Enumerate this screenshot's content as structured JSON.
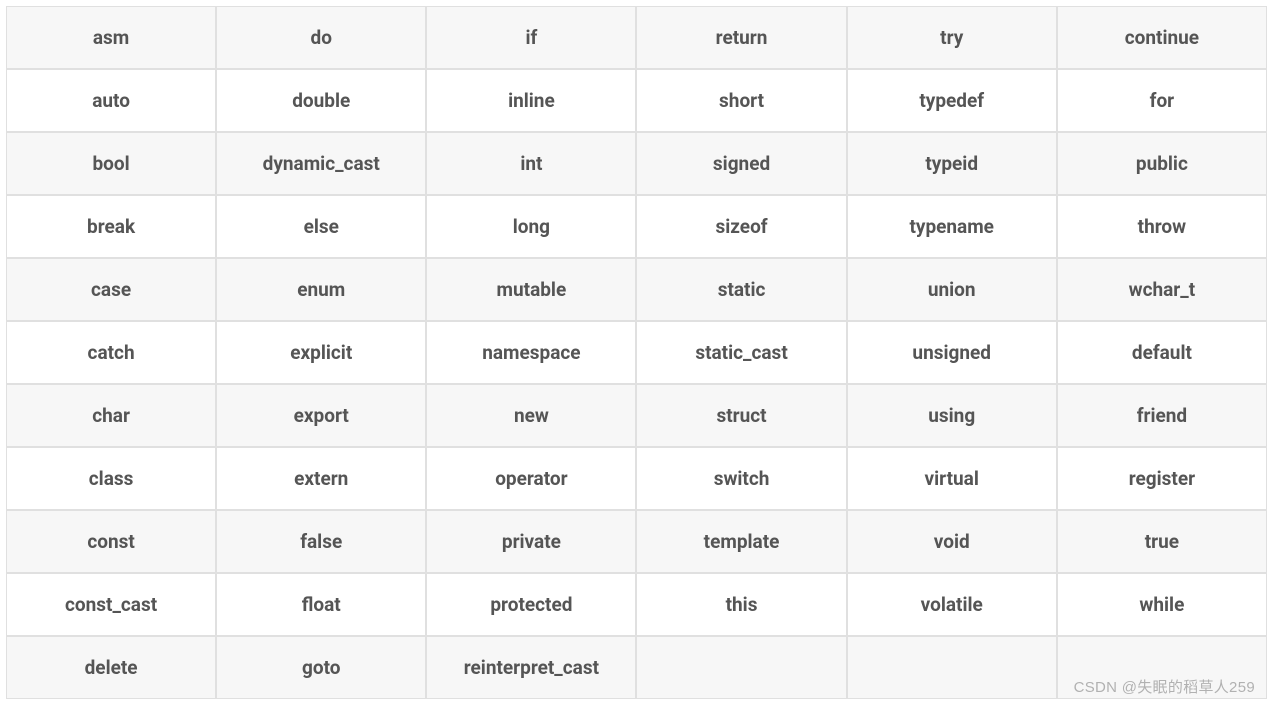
{
  "table": {
    "rows": [
      [
        "asm",
        "do",
        "if",
        "return",
        "try",
        "continue"
      ],
      [
        "auto",
        "double",
        "inline",
        "short",
        "typedef",
        "for"
      ],
      [
        "bool",
        "dynamic_cast",
        "int",
        "signed",
        "typeid",
        "public"
      ],
      [
        "break",
        "else",
        "long",
        "sizeof",
        "typename",
        "throw"
      ],
      [
        "case",
        "enum",
        "mutable",
        "static",
        "union",
        "wchar_t"
      ],
      [
        "catch",
        "explicit",
        "namespace",
        "static_cast",
        "unsigned",
        "default"
      ],
      [
        "char",
        "export",
        "new",
        "struct",
        "using",
        "friend"
      ],
      [
        "class",
        "extern",
        "operator",
        "switch",
        "virtual",
        "register"
      ],
      [
        "const",
        "false",
        "private",
        "template",
        "void",
        "true"
      ],
      [
        "const_cast",
        "float",
        "protected",
        "this",
        "volatile",
        "while"
      ],
      [
        "delete",
        "goto",
        "reinterpret_cast",
        "",
        "",
        ""
      ]
    ]
  },
  "watermark": "CSDN @失眠的稻草人259"
}
